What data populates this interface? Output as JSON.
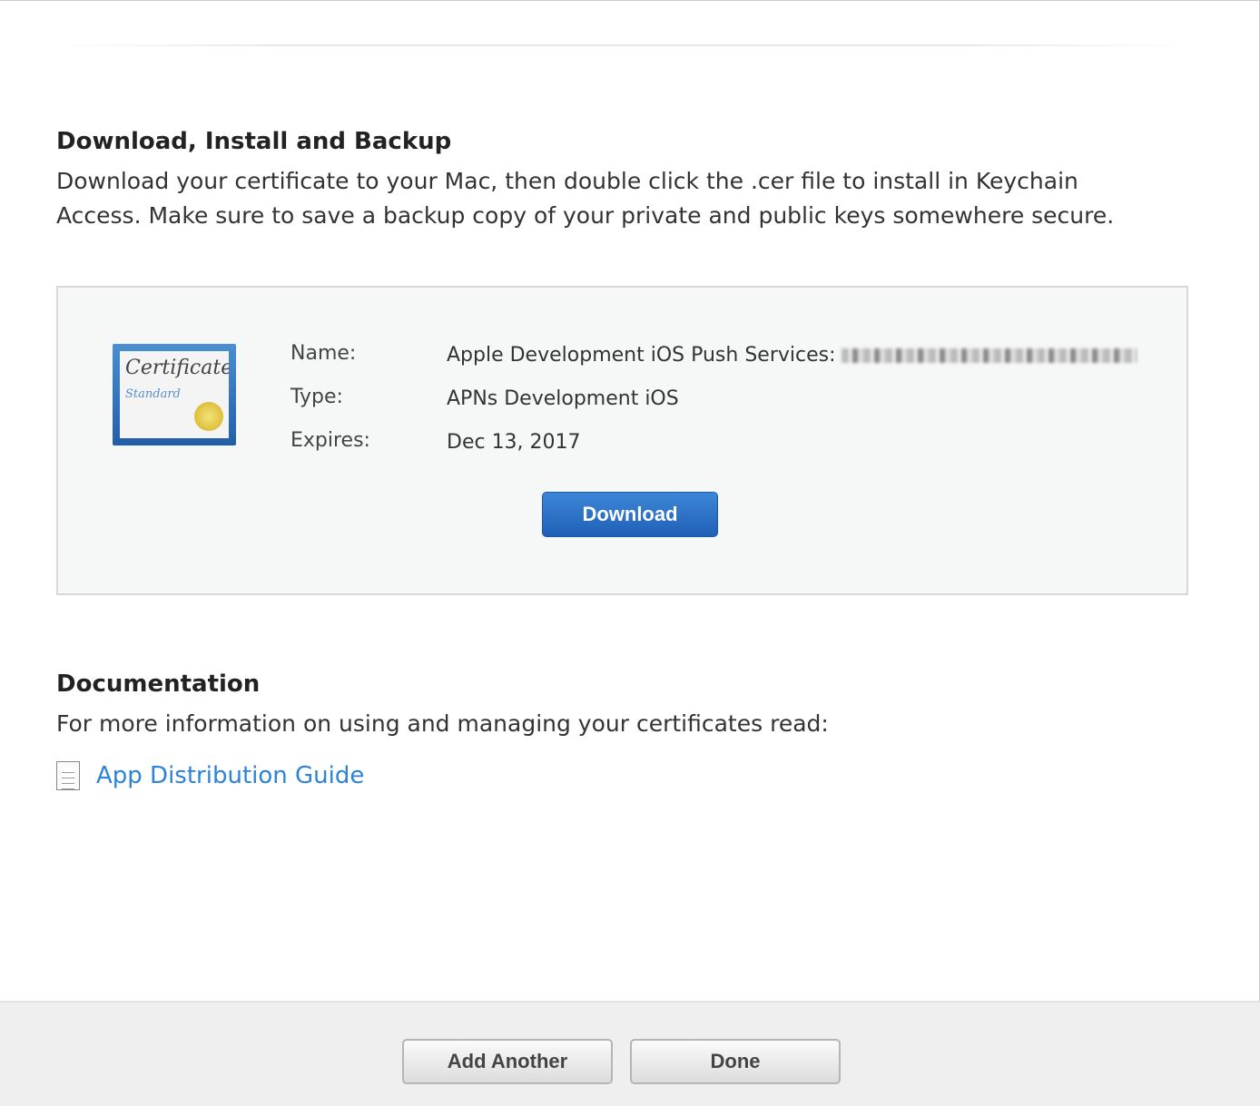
{
  "install": {
    "title": "Download, Install and Backup",
    "text": "Download your certificate to your Mac, then double click the .cer file to install in Keychain Access. Make sure to save a backup copy of your private and public keys somewhere secure."
  },
  "certificate": {
    "icon_title": "Certificate",
    "icon_subtitle": "Standard",
    "name_label": "Name:",
    "name_value": "Apple Development iOS Push Services:",
    "type_label": "Type:",
    "type_value": "APNs Development iOS",
    "expires_label": "Expires:",
    "expires_value": "Dec 13, 2017",
    "download_label": "Download"
  },
  "documentation": {
    "title": "Documentation",
    "text": "For more information on using and managing your certificates read:",
    "link": "App Distribution Guide"
  },
  "footer": {
    "add_another": "Add Another",
    "done": "Done"
  }
}
